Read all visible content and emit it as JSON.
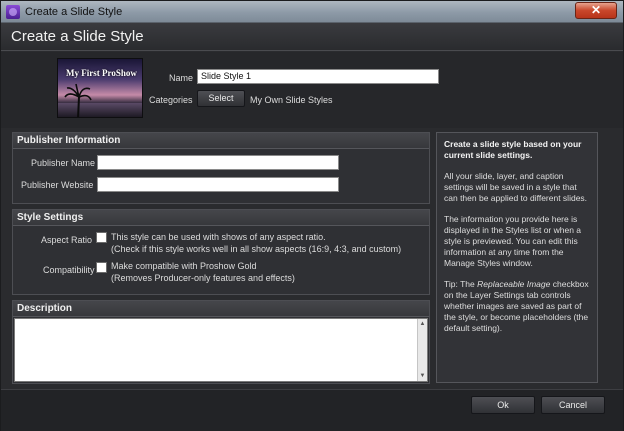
{
  "window": {
    "title": "Create a Slide Style",
    "close_glyph": "✕"
  },
  "header": {
    "title": "Create a Slide Style"
  },
  "thumbnail": {
    "text": "My First ProShow"
  },
  "form": {
    "name_label": "Name",
    "name_value": "Slide Style 1",
    "categories_label": "Categories",
    "select_button": "Select",
    "categories_value": "My Own Slide Styles"
  },
  "publisher": {
    "heading": "Publisher Information",
    "name_label": "Publisher Name",
    "name_value": "",
    "website_label": "Publisher Website",
    "website_value": ""
  },
  "style_settings": {
    "heading": "Style Settings",
    "aspect_label": "Aspect Ratio",
    "aspect_text_1": "This style can be used with shows of any aspect ratio.",
    "aspect_text_2": "(Check if this style works well in all show aspects (16:9, 4:3, and custom)",
    "compat_label": "Compatibility",
    "compat_text_1": "Make compatible with Proshow Gold",
    "compat_text_2": "(Removes Producer-only features and effects)"
  },
  "description": {
    "heading": "Description",
    "value": ""
  },
  "help": {
    "intro": "Create a slide style based on your current slide settings.",
    "p1": "All your slide, layer, and caption settings will be saved in a style that can then be applied to different slides.",
    "p2": "The information you provide here is displayed in the Styles list or when a style is previewed. You can edit this information at any time from the Manage Styles window.",
    "tip_label": "Tip:",
    "tip_pre": "The",
    "tip_italic": "Replaceable Image",
    "tip_post": "checkbox on the Layer Settings tab controls whether images are saved as part of the style, or become placeholders (the default setting)."
  },
  "footer": {
    "ok": "Ok",
    "cancel": "Cancel"
  },
  "colors": {
    "window_bg": "#2a2b2e",
    "titlebar": "#8d9aa7",
    "close": "#c9472b"
  }
}
